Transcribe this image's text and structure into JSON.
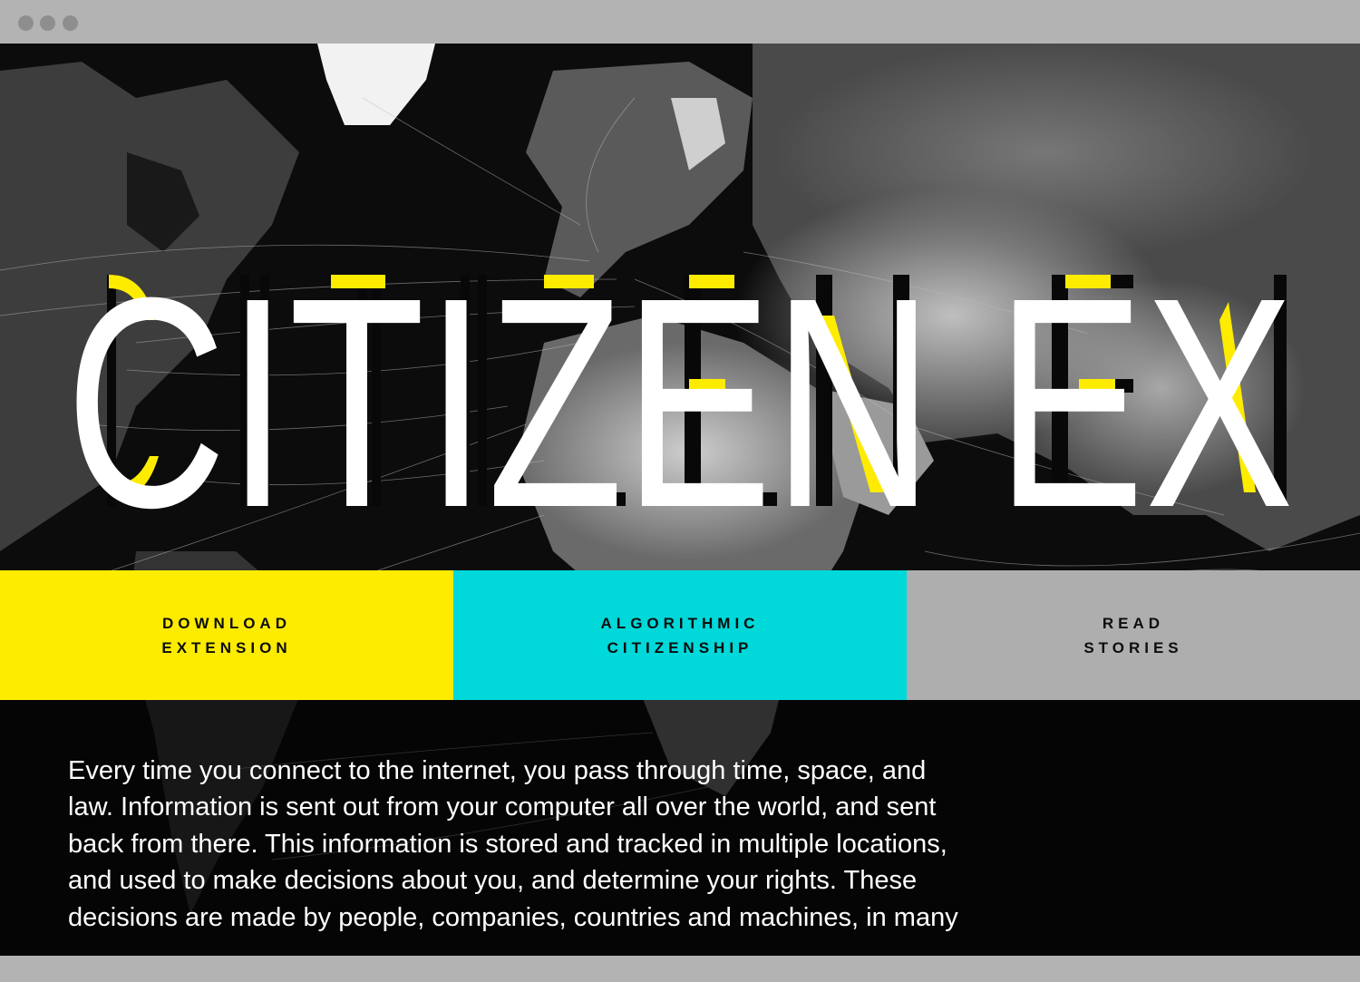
{
  "hero": {
    "title": "CITIZEN EX",
    "accent_yellow": "#fdec00"
  },
  "nav": {
    "buttons": [
      {
        "line1": "DOWNLOAD",
        "line2": "EXTENSION",
        "color": "#fdec00"
      },
      {
        "line1": "ALGORITHMIC",
        "line2": "CITIZENSHIP",
        "color": "#00d8d9"
      },
      {
        "line1": "READ",
        "line2": "STORIES",
        "color": "#aeaeae"
      }
    ]
  },
  "intro": {
    "text": "Every time you connect to the internet, you pass through time, space, and law. Information is sent out from your computer all over the world, and sent back from there. This information is stored and tracked in multiple locations, and used to make decisions about you, and determine your rights. These decisions are made by people, companies, countries and machines, in many"
  },
  "window": {
    "controls": [
      "window-dot",
      "window-dot",
      "window-dot"
    ]
  }
}
